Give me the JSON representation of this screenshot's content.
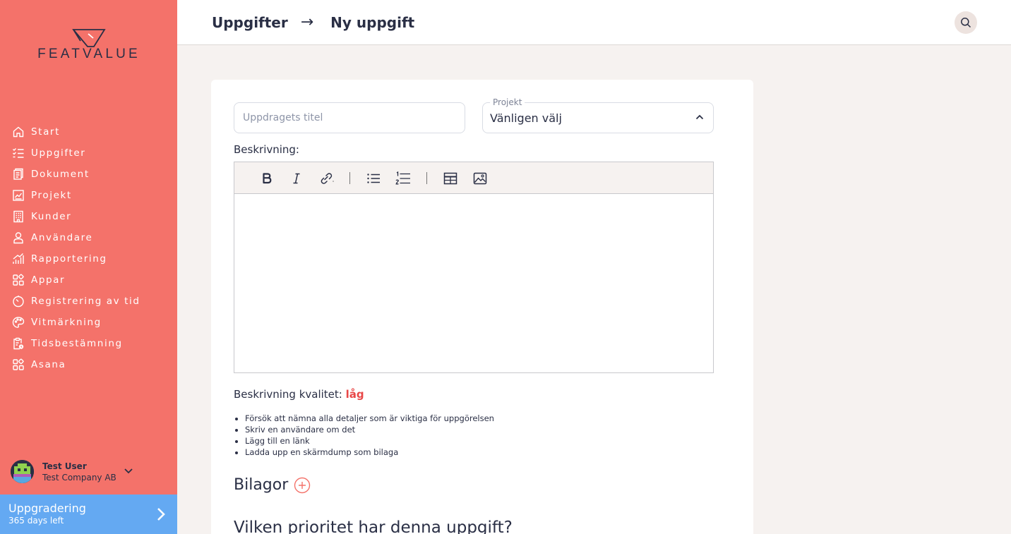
{
  "brand": {
    "name": "FEATVALUE"
  },
  "sidebar": {
    "items": [
      {
        "label": "Start",
        "icon": "home-icon"
      },
      {
        "label": "Uppgifter",
        "icon": "checklist-icon"
      },
      {
        "label": "Dokument",
        "icon": "document-icon"
      },
      {
        "label": "Projekt",
        "icon": "chart-icon"
      },
      {
        "label": "Kunder",
        "icon": "building-icon"
      },
      {
        "label": "Användare",
        "icon": "user-icon"
      },
      {
        "label": "Rapportering",
        "icon": "bars-icon"
      },
      {
        "label": "Appar",
        "icon": "apps-icon"
      },
      {
        "label": "Registrering av tid",
        "icon": "timer-icon"
      },
      {
        "label": "Vitmärkning",
        "icon": "palette-icon"
      },
      {
        "label": "Tidsbestämning",
        "icon": "clipboard-clock-icon"
      },
      {
        "label": "Asana",
        "icon": "apps-icon"
      }
    ],
    "user": {
      "name": "Test User",
      "company": "Test Company AB"
    },
    "upgrade": {
      "title": "Uppgradering",
      "subtitle": "365 days left"
    }
  },
  "header": {
    "breadcrumb": {
      "parent": "Uppgifter",
      "separator": "→",
      "current": "Ny uppgift"
    }
  },
  "form": {
    "title_placeholder": "Uppdragets titel",
    "title_value": "",
    "project": {
      "label": "Projekt",
      "value": "Vänligen välj"
    },
    "description_label": "Beskrivning:",
    "quality_label": "Beskrivning kvalitet:",
    "quality_value": "låg",
    "tips": [
      "Försök att nämna alla detaljer som är viktiga för uppgörelsen",
      "Skriv en användare om det",
      "Lägg till en länk",
      "Ladda upp en skärmdump som bilaga"
    ],
    "attachments_title": "Bilagor",
    "priority_question": "Vilken prioritet har denna uppgift?"
  },
  "colors": {
    "sidebar": "#f4726a",
    "upgrade": "#64a9f2",
    "text": "#2a2f45",
    "quality_low": "#e84848"
  }
}
